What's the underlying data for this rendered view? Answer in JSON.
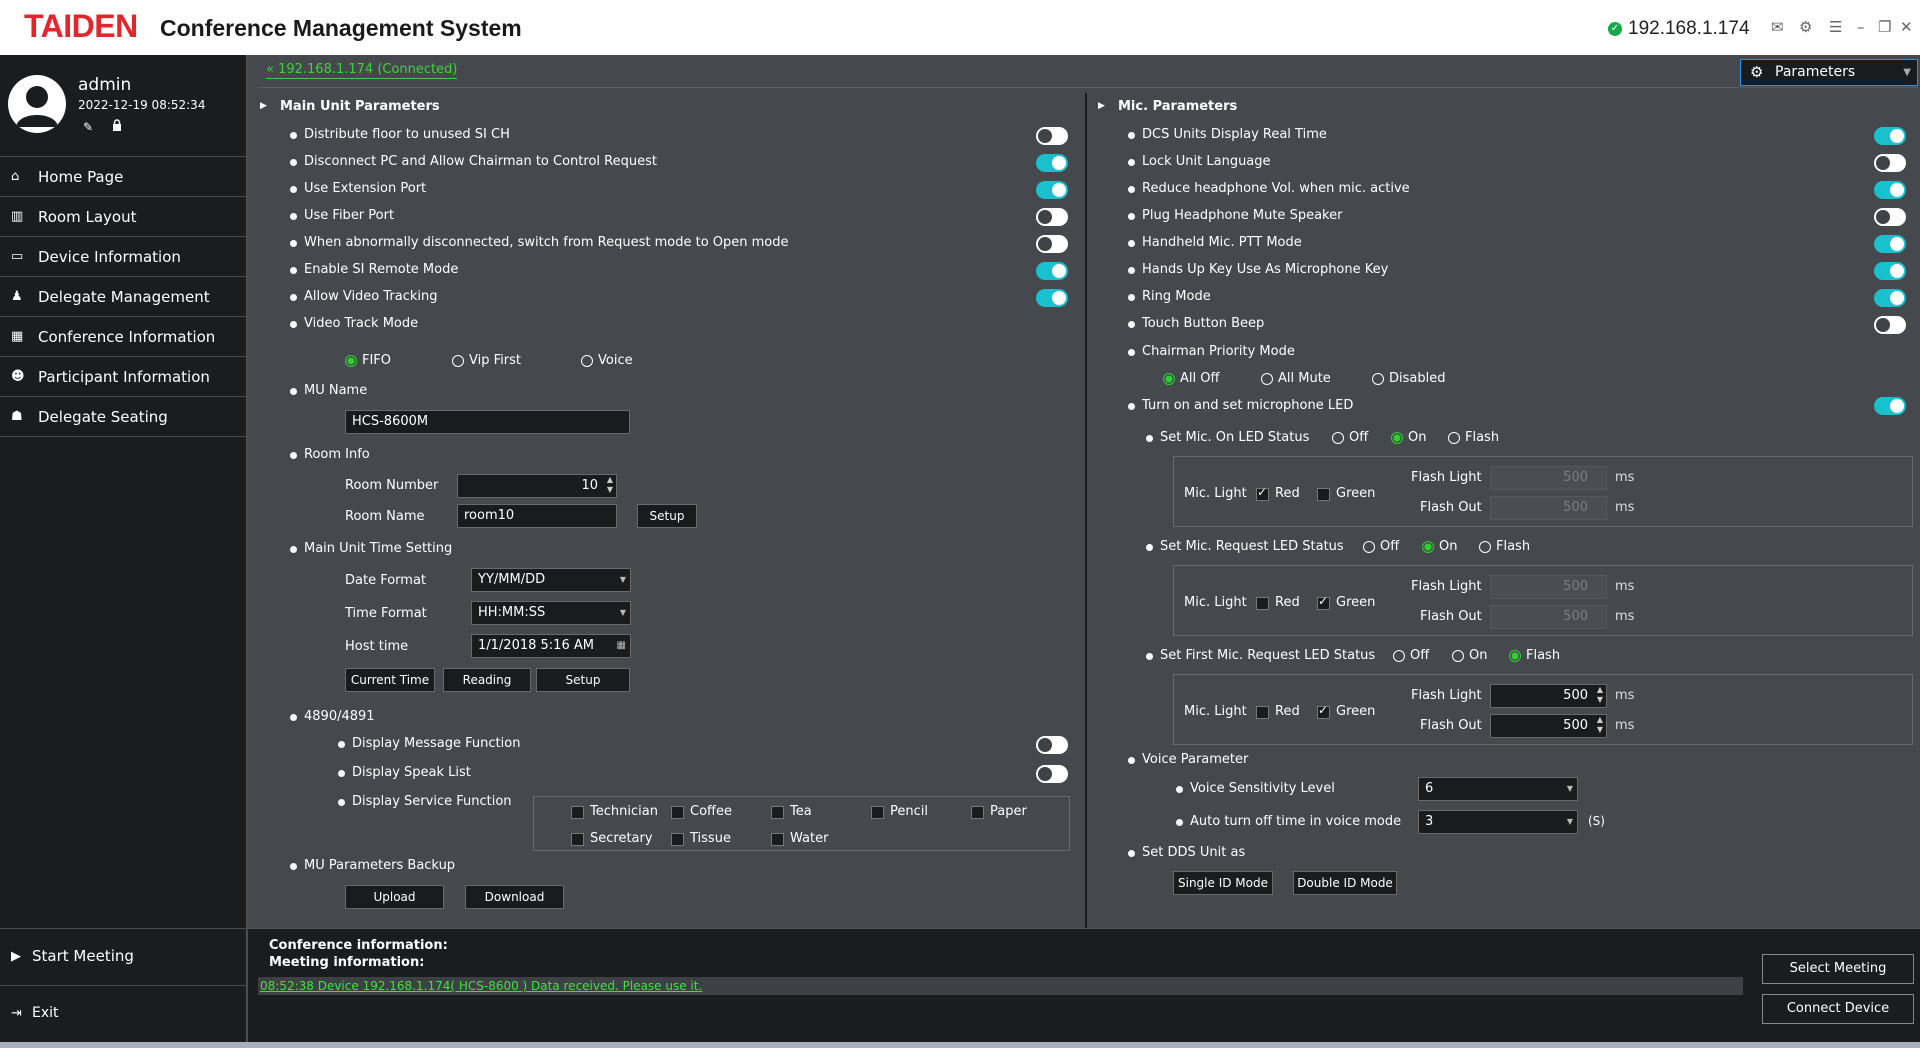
{
  "app": {
    "logo": "TAIDEN",
    "title": "Conference Management System",
    "ip": "192.168.1.174"
  },
  "user": {
    "name": "admin",
    "datetime": "2022-12-19 08:52:34"
  },
  "sidebar": {
    "items": [
      {
        "label": "Home Page",
        "icon": "home-icon"
      },
      {
        "label": "Room Layout",
        "icon": "map-icon"
      },
      {
        "label": "Device Information",
        "icon": "device-icon"
      },
      {
        "label": "Delegate Management",
        "icon": "person-icon"
      },
      {
        "label": "Conference Information",
        "icon": "table-icon"
      },
      {
        "label": "Participant Information",
        "icon": "participant-icon"
      },
      {
        "label": "Delegate Seating",
        "icon": "group-icon"
      }
    ],
    "start_meeting": "Start Meeting",
    "exit": "Exit"
  },
  "crumb": "« 192.168.1.174 (Connected)",
  "param_select": "Parameters",
  "main_unit": {
    "title": "Main Unit Parameters",
    "toggles": [
      {
        "label": "Distribute floor to unused SI CH",
        "on": false
      },
      {
        "label": "Disconnect PC and Allow Chairman to Control Request",
        "on": true
      },
      {
        "label": "Use Extension Port",
        "on": true
      },
      {
        "label": "Use Fiber Port",
        "on": false
      },
      {
        "label": "When abnormally disconnected, switch from Request mode to Open mode",
        "on": false
      },
      {
        "label": "Enable SI Remote Mode",
        "on": true
      },
      {
        "label": "Allow Video Tracking",
        "on": true
      }
    ],
    "video_track_mode": {
      "label": "Video Track Mode",
      "options": [
        "FIFO",
        "Vip First",
        "Voice"
      ],
      "selected": "FIFO"
    },
    "mu_name": {
      "label": "MU Name",
      "value": "HCS-8600M"
    },
    "room_info": {
      "label": "Room Info",
      "room_number_label": "Room Number",
      "room_number": "10",
      "room_name_label": "Room Name",
      "room_name": "room10",
      "setup": "Setup"
    },
    "time_setting": {
      "label": "Main Unit Time Setting",
      "date_format_label": "Date Format",
      "date_format": "YY/MM/DD",
      "time_format_label": "Time Format",
      "time_format": "HH:MM:SS",
      "host_time_label": "Host time",
      "host_time": "1/1/2018 5:16 AM",
      "current_time": "Current Time",
      "reading": "Reading",
      "setup": "Setup"
    },
    "r4890": {
      "label": "4890/4891",
      "display_message": "Display Message Function",
      "display_message_on": false,
      "display_speak": "Display Speak List",
      "display_speak_on": false,
      "display_service": "Display Service Function",
      "services": [
        "Technician",
        "Coffee",
        "Tea",
        "Pencil",
        "Paper",
        "Secretary",
        "Tissue",
        "Water"
      ]
    },
    "backup": {
      "label": "MU Parameters Backup",
      "upload": "Upload",
      "download": "Download"
    }
  },
  "mic": {
    "title": "Mic. Parameters",
    "toggles": [
      {
        "label": "DCS Units Display Real Time",
        "on": true
      },
      {
        "label": "Lock Unit Language",
        "on": false
      },
      {
        "label": "Reduce headphone Vol. when mic. active",
        "on": true
      },
      {
        "label": "Plug Headphone Mute Speaker",
        "on": false
      },
      {
        "label": "Handheld Mic. PTT Mode",
        "on": true
      },
      {
        "label": "Hands Up Key Use As Microphone Key",
        "on": true
      },
      {
        "label": "Ring Mode",
        "on": true
      },
      {
        "label": "Touch Button Beep",
        "on": false
      }
    ],
    "chairman_priority": {
      "label": "Chairman Priority Mode",
      "options": [
        "All Off",
        "All Mute",
        "Disabled"
      ],
      "selected": "All Off"
    },
    "led": {
      "label": "Turn on and set microphone LED",
      "on": true,
      "groups": [
        {
          "label": "Set Mic. On LED Status",
          "options": [
            "Off",
            "On",
            "Flash"
          ],
          "selected": "On",
          "mic_light": "Mic. Light",
          "red": "Red",
          "red_checked": true,
          "green": "Green",
          "green_checked": false,
          "flash_light": "Flash Light",
          "flash_light_value": "500",
          "flash_out": "Flash Out",
          "flash_out_value": "500",
          "unit": "ms",
          "enabled": false
        },
        {
          "label": "Set Mic. Request LED Status",
          "options": [
            "Off",
            "On",
            "Flash"
          ],
          "selected": "On",
          "mic_light": "Mic. Light",
          "red": "Red",
          "red_checked": false,
          "green": "Green",
          "green_checked": true,
          "flash_light": "Flash Light",
          "flash_light_value": "500",
          "flash_out": "Flash Out",
          "flash_out_value": "500",
          "unit": "ms",
          "enabled": false
        },
        {
          "label": "Set First Mic. Request LED Status",
          "options": [
            "Off",
            "On",
            "Flash"
          ],
          "selected": "Flash",
          "mic_light": "Mic. Light",
          "red": "Red",
          "red_checked": false,
          "green": "Green",
          "green_checked": true,
          "flash_light": "Flash Light",
          "flash_light_value": "500",
          "flash_out": "Flash Out",
          "flash_out_value": "500",
          "unit": "ms",
          "enabled": true
        }
      ]
    },
    "voice": {
      "label": "Voice Parameter",
      "sensitivity_label": "Voice Sensitivity Level",
      "sensitivity": "6",
      "auto_off_label": "Auto turn off time in voice mode",
      "auto_off": "3",
      "unit": "(S)"
    },
    "dds": {
      "label": "Set DDS Unit as",
      "single": "Single ID Mode",
      "double": "Double ID Mode"
    }
  },
  "bottom": {
    "conf_info": "Conference information:",
    "meet_info": "Meeting information:",
    "log": "08:52:38   Device 192.168.1.174( HCS-8600 ) Data received. Please use it.",
    "select_meeting": "Select Meeting",
    "connect_device": "Connect Device"
  }
}
